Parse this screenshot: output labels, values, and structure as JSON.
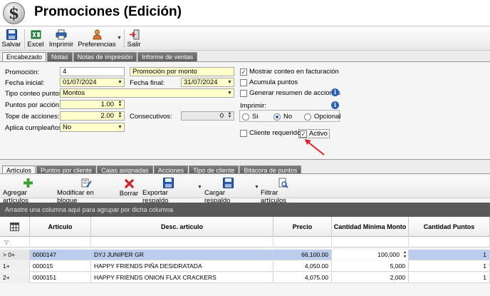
{
  "window": {
    "title": "Promociones (Edición)"
  },
  "toolbar": {
    "save": "Salvar",
    "excel": "Excel",
    "print": "Imprimir",
    "preferences": "Preferencias",
    "exit": "Salir"
  },
  "top_tabs": [
    "Encabezado",
    "Notas",
    "Notas de impresión",
    "Informe de ventas"
  ],
  "form": {
    "promocion_label": "Promoción:",
    "promocion_value": "4",
    "promocion_desc": "Promoción por monto",
    "fecha_inicial_label": "Fecha inicial:",
    "fecha_inicial_value": "01/07/2024",
    "fecha_final_label": "Fecha final:",
    "fecha_final_value": "31/07/2024",
    "tipo_conteo_label": "Tipo conteo puntos:",
    "tipo_conteo_value": "Montos",
    "puntos_accion_label": "Puntos por acción:",
    "puntos_accion_value": "1.00",
    "tope_acciones_label": "Tope de acciones:",
    "tope_acciones_value": "2.00",
    "consecutivos_label": "Consecutivos:",
    "consecutivos_value": "0",
    "aplica_cumple_label": "Aplica cumpleaños:",
    "aplica_cumple_value": "No",
    "mostrar_conteo": "Mostrar conteo en facturación",
    "acumula_puntos": "Acumula puntos",
    "generar_resumen": "Generar resumen de acciones",
    "imprimir_label": "Imprimir:",
    "radio_si": "Si",
    "radio_no": "No",
    "radio_opcional": "Opcional",
    "cliente_requerido": "Cliente requerido",
    "activo": "Activo"
  },
  "bottom_tabs": [
    "Artículos",
    "Puntos por cliente",
    "Cajas asignadas",
    "Acciones",
    "Tipo de cliente",
    "Bitácora de puntos"
  ],
  "toolbar2": {
    "add": "Agregar artículos",
    "bulk_edit": "Modificar en bloque",
    "delete": "Borrar",
    "export": "Exportar respaldo",
    "load": "Cargar respaldo",
    "filter": "Filtrar artículos"
  },
  "group_hint": "Arrastre una columna aquí para agrupar por dicha columna",
  "grid": {
    "columns": [
      "Artículo",
      "Desc. artículo",
      "Precio",
      "Cantidad Mínima Monto",
      "Cantidad Puntos"
    ],
    "rows": [
      {
        "idx": "0+",
        "articulo": "0000147",
        "desc": "DYJ JUNIPER GR",
        "precio": "66,100.00",
        "cantidad": "100,000",
        "puntos": "1"
      },
      {
        "idx": "1+",
        "articulo": "000015",
        "desc": "HAPPY FRIENDS PIÑA DESIDRATADA",
        "precio": "4,050.00",
        "cantidad": "5,000",
        "puntos": "1"
      },
      {
        "idx": "2+",
        "articulo": "0000151",
        "desc": "HAPPY FRIENDS ONION FLAX CRACKERS",
        "precio": "4,075.00",
        "cantidad": "2,000",
        "puntos": "1"
      }
    ]
  },
  "colors": {
    "accent": "#2a5fb9",
    "selected_row": "#bcccec",
    "highlight_field": "#ffffcc",
    "arrow": "#e0202a"
  }
}
